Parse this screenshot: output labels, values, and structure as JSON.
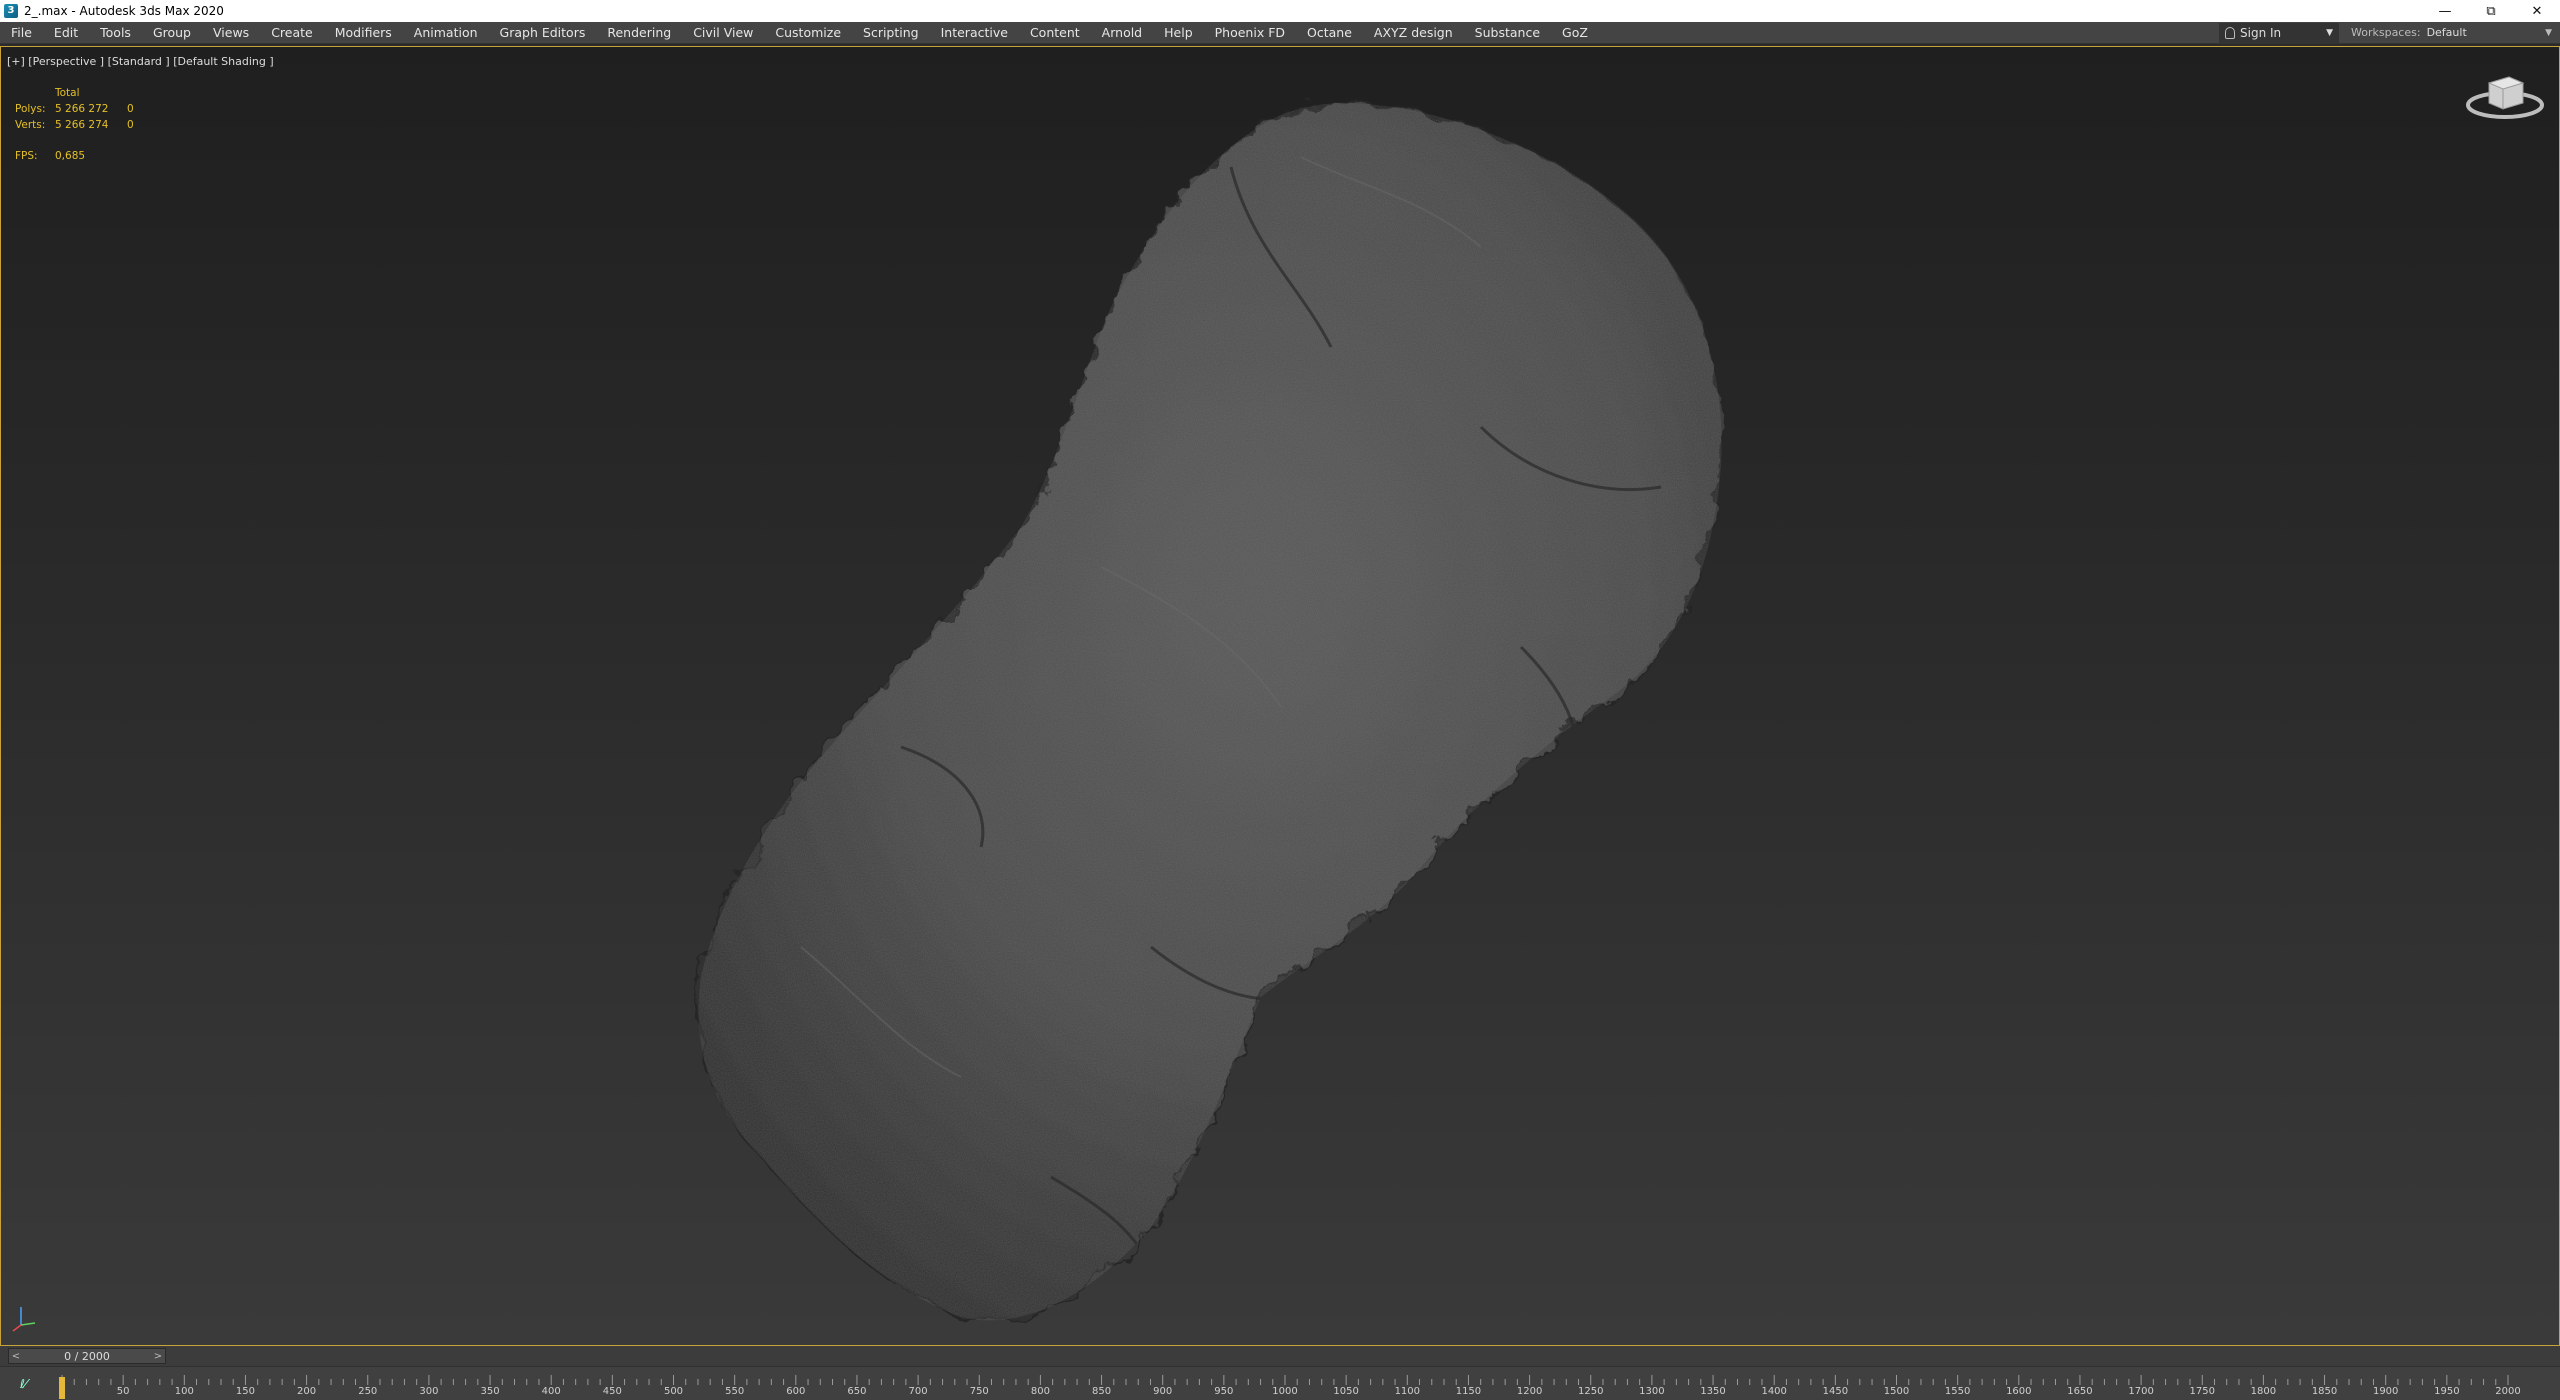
{
  "window": {
    "title": "2_.max - Autodesk 3ds Max 2020"
  },
  "menu": {
    "items": [
      "File",
      "Edit",
      "Tools",
      "Group",
      "Views",
      "Create",
      "Modifiers",
      "Animation",
      "Graph Editors",
      "Rendering",
      "Civil View",
      "Customize",
      "Scripting",
      "Interactive",
      "Content",
      "Arnold",
      "Help",
      "Phoenix FD",
      "Octane",
      "AXYZ design",
      "Substance",
      "GoZ"
    ],
    "signin_label": "Sign In",
    "workspaces_label": "Workspaces:",
    "workspaces_value": "Default"
  },
  "viewport": {
    "label": "[+] [Perspective ] [Standard ] [Default Shading ]",
    "stats": {
      "total_label": "Total",
      "polys_label": "Polys:",
      "polys_value": "5 266 272",
      "polys_sel": "0",
      "verts_label": "Verts:",
      "verts_value": "5 266 274",
      "verts_sel": "0",
      "fps_label": "FPS:",
      "fps_value": "0,685"
    }
  },
  "timeline": {
    "slider_label": "0 / 2000",
    "prev": "<",
    "next": ">",
    "tick_labels": [
      "50",
      "100",
      "150",
      "200",
      "250",
      "300",
      "350",
      "400",
      "450",
      "500",
      "550",
      "600",
      "650",
      "700",
      "750",
      "800",
      "850",
      "900",
      "950",
      "1000",
      "1050",
      "1100",
      "1150",
      "1200",
      "1250",
      "1300",
      "1350",
      "1400",
      "1450",
      "1500",
      "1550",
      "1600",
      "1650",
      "1700",
      "1750",
      "1800",
      "1850",
      "1900",
      "1950",
      "2000"
    ]
  },
  "icons": {
    "app": "3ds-max-app-icon",
    "minimize": "minimize-icon",
    "restore": "restore-icon",
    "close": "close-icon",
    "viewcube": "viewcube-icon",
    "axis": "axis-tripod-icon"
  },
  "colors": {
    "accent": "#e5c027",
    "viewport_border": "#c8a23a",
    "menubar": "#444444"
  }
}
